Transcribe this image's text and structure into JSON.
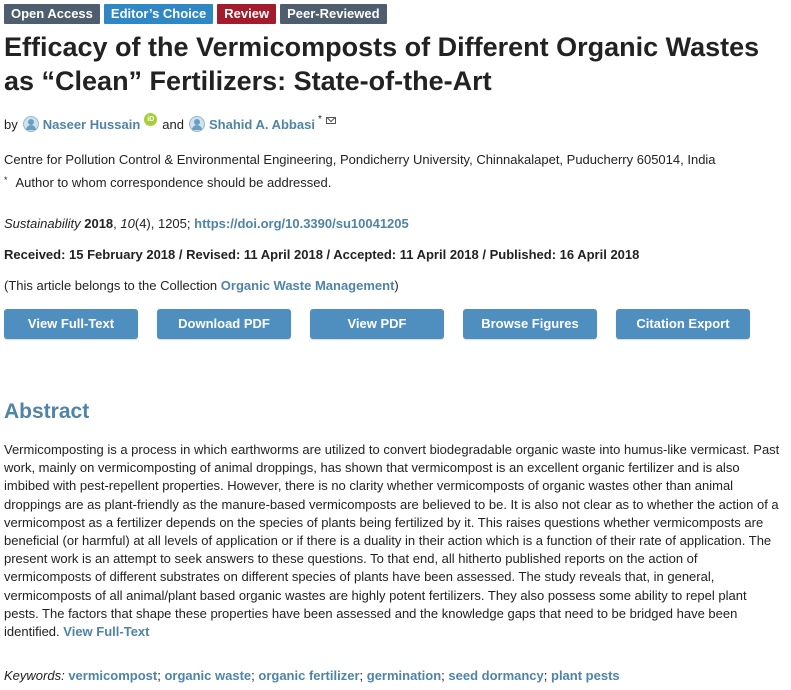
{
  "badges": [
    "Open Access",
    "Editor’s Choice",
    "Review",
    "Peer-Reviewed"
  ],
  "title": "Efficacy of the Vermicomposts of Different Organic Wastes as “Clean” Fertilizers: State-of-the-Art",
  "authors": {
    "by": "by",
    "author1": "Naseer Hussain",
    "and": "and",
    "author2": "Shahid A. Abbasi",
    "corr_mark": "*"
  },
  "affiliation": "Centre for Pollution Control & Environmental Engineering, Pondicherry University, Chinnakalapet, Puducherry 605014, India",
  "correspondence": {
    "mark": "*",
    "text": "Author to whom correspondence should be addressed."
  },
  "citation": {
    "journal": "Sustainability",
    "year": "2018",
    "volume": "10",
    "issue_pages": "(4), 1205;",
    "doi": "https://doi.org/10.3390/su10041205"
  },
  "dates": "Received: 15 February 2018 / Revised: 11 April 2018 / Accepted: 11 April 2018 / Published: 16 April 2018",
  "collection": {
    "prefix": "(This article belongs to the Collection",
    "name": "Organic Waste Management",
    "suffix": ")"
  },
  "buttons": [
    "View Full-Text",
    "Download PDF",
    "View PDF",
    "Browse Figures",
    "Citation Export"
  ],
  "abstract": {
    "heading": "Abstract",
    "text": "Vermicomposting is a process in which earthworms are utilized to convert biodegradable organic waste into humus-like vermicast. Past work, mainly on vermicomposting of animal droppings, has shown that vermicompost is an excellent organic fertilizer and is also imbibed with pest-repellent properties. However, there is no clarity whether vermicomposts of organic wastes other than animal droppings are as plant-friendly as the manure-based vermicomposts are believed to be. It is also not clear as to whether the action of a vermicompost as a fertilizer depends on the species of plants being fertilized by it. This raises questions whether vermicomposts are beneficial (or harmful) at all levels of application or if there is a duality in their action which is a function of their rate of application. The present work is an attempt to seek answers to these questions. To that end, all hitherto published reports on the action of vermicomposts of different substrates on different species of plants have been assessed. The study reveals that, in general, vermicomposts of all animal/plant based organic wastes are highly potent fertilizers. They also possess some ability to repel plant pests. The factors that shape these properties have been assessed and the knowledge gaps that need to be bridged have been identified.",
    "link": "View Full-Text"
  },
  "keywords": {
    "label": "Keywords:",
    "items": [
      "vermicompost",
      "organic waste",
      "organic fertilizer",
      "germination",
      "seed dormancy",
      "plant pests"
    ]
  },
  "colors": {
    "link": "#4f84a8",
    "button": "#4f8fbf",
    "badge_dark": "#4f5e6e",
    "badge_blue": "#2f87c4",
    "badge_red": "#a21c2c"
  }
}
